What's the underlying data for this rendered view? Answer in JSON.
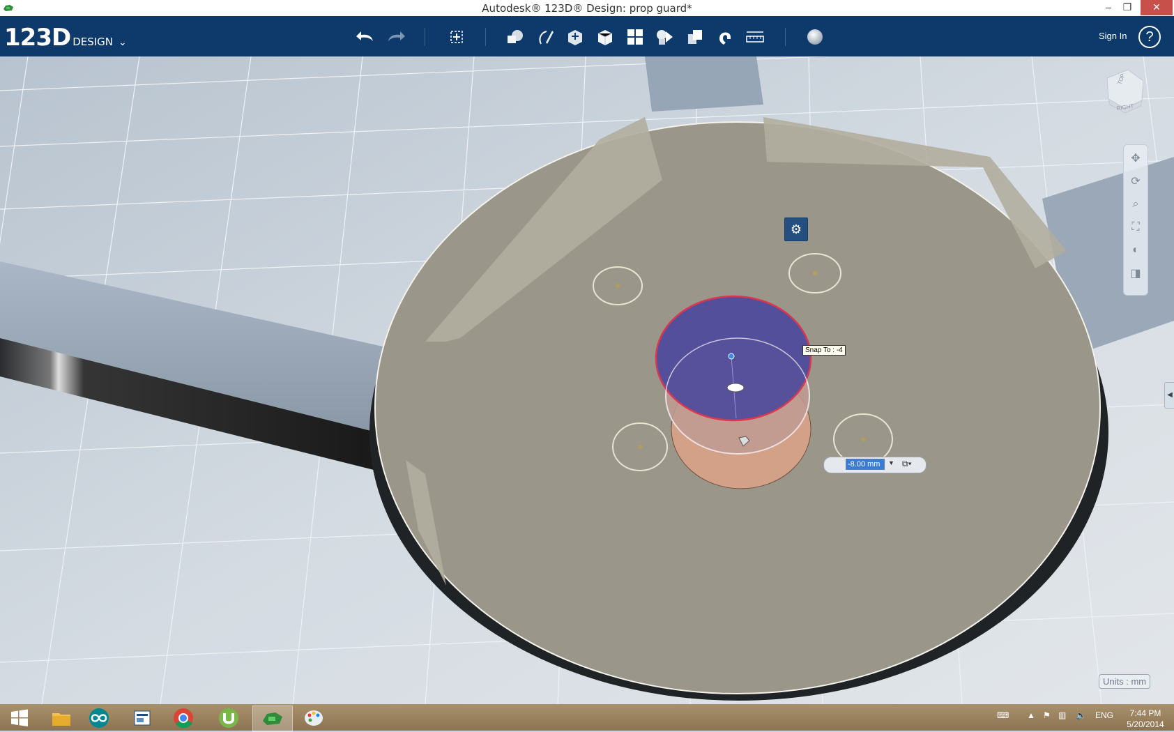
{
  "window": {
    "title": "Autodesk® 123D® Design: prop guard*",
    "minimize": "–",
    "restore": "❐",
    "close": "✕"
  },
  "toolbar": {
    "logo_big": "123D",
    "logo_small": "DESIGN",
    "sign_in": "Sign In",
    "help": "?",
    "icons": [
      "undo-icon",
      "redo-icon",
      "transform-icon",
      "primitives-icon",
      "sketch-icon",
      "construct-icon",
      "modify-icon",
      "pattern-icon",
      "grouping-icon",
      "combine-icon",
      "snap-icon",
      "measure-icon",
      "material-icon"
    ]
  },
  "viewport": {
    "viewcube": {
      "top_label": "TOP",
      "right_label": "RIGHT"
    },
    "snap_tooltip": "Snap To : -4",
    "dimension_value": "-8.00 mm",
    "units_label": "Units : mm",
    "nav_icons": [
      "pan-icon",
      "orbit-icon",
      "zoom-icon",
      "fit-icon",
      "view-mode-icon",
      "material-view-icon"
    ]
  },
  "taskbar": {
    "apps": [
      "windows-start-icon",
      "file-explorer-icon",
      "arduino-icon",
      "reader-icon",
      "chrome-icon",
      "utorrent-icon",
      "123d-design-icon",
      "paint-icon"
    ],
    "language": "ENG",
    "time": "7:44 PM",
    "date": "5/20/2014"
  },
  "colors": {
    "toolbar_bg": "#0d3a6b",
    "disk_fill": "#9b968a",
    "selection_blue": "#5a55a8",
    "preview_orange": "#dba083"
  }
}
